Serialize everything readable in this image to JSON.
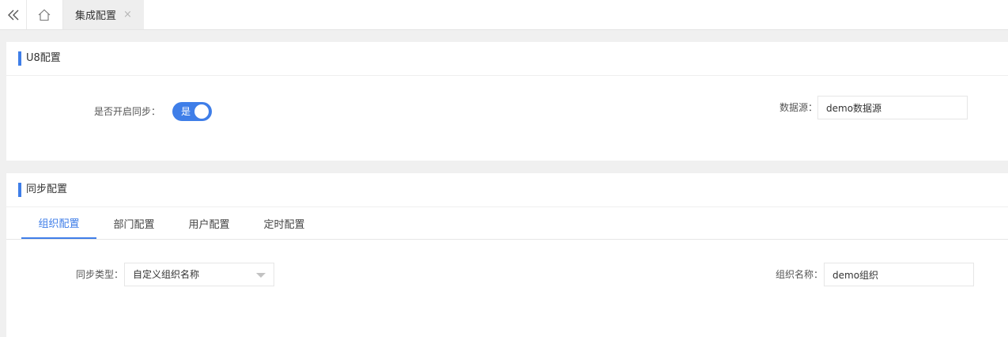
{
  "topbar": {
    "collapse_icon": "double-chevron-left-icon",
    "home_icon": "home-icon",
    "active_tab": {
      "label": "集成配置",
      "close": "×"
    }
  },
  "u8_section": {
    "title": "U8配置",
    "sync_enabled": {
      "label": "是否开启同步：",
      "value": true,
      "on_text": "是"
    },
    "datasource": {
      "label": "数据源：",
      "value": "demo数据源"
    }
  },
  "sync_section": {
    "title": "同步配置",
    "tabs": [
      {
        "label": "组织配置",
        "active": true
      },
      {
        "label": "部门配置",
        "active": false
      },
      {
        "label": "用户配置",
        "active": false
      },
      {
        "label": "定时配置",
        "active": false
      }
    ],
    "sync_type": {
      "label": "同步类型：",
      "value": "自定义组织名称"
    },
    "org_name": {
      "label": "组织名称：",
      "value": "demo组织"
    }
  },
  "colors": {
    "accent": "#3f7ee8",
    "background": "#f0f0f0"
  }
}
